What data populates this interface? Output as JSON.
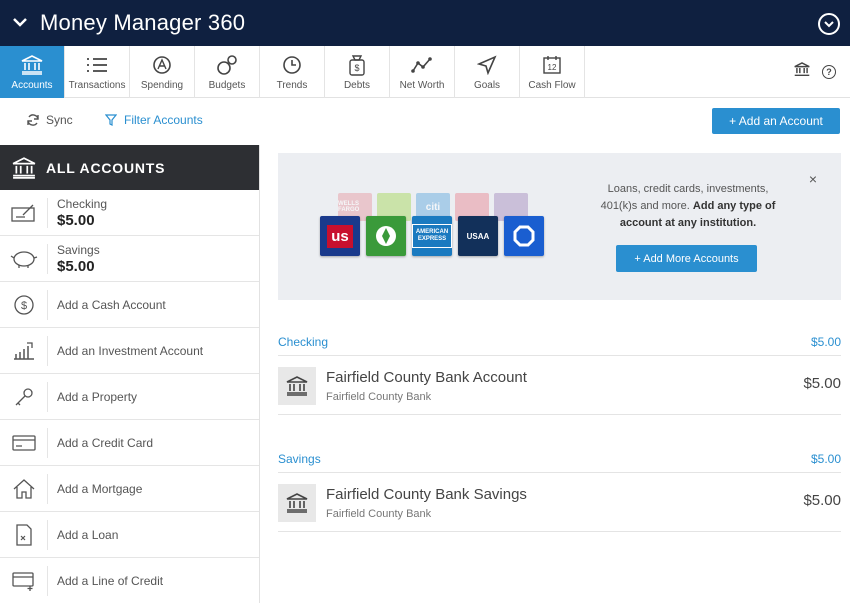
{
  "app": {
    "title": "Money Manager 360"
  },
  "nav": {
    "items": [
      {
        "label": "Accounts",
        "icon": "bank-icon",
        "active": true
      },
      {
        "label": "Transactions",
        "icon": "list-icon"
      },
      {
        "label": "Spending",
        "icon": "spending-icon"
      },
      {
        "label": "Budgets",
        "icon": "budgets-icon"
      },
      {
        "label": "Trends",
        "icon": "clock-icon"
      },
      {
        "label": "Debts",
        "icon": "debts-icon"
      },
      {
        "label": "Net Worth",
        "icon": "networth-icon"
      },
      {
        "label": "Goals",
        "icon": "goals-icon"
      },
      {
        "label": "Cash Flow",
        "icon": "calendar-icon",
        "calendar_day": "12"
      }
    ],
    "right_icons": [
      "bank-icon",
      "help-icon"
    ],
    "help_glyph": "?"
  },
  "toolbar": {
    "sync_label": "Sync",
    "filter_label": "Filter Accounts",
    "add_account_label": "+ Add an Account"
  },
  "sidebar": {
    "header": "ALL ACCOUNTS",
    "accounts": [
      {
        "name": "Checking",
        "balance": "$5.00",
        "icon": "checkbook-icon"
      },
      {
        "name": "Savings",
        "balance": "$5.00",
        "icon": "piggy-bank-icon"
      }
    ],
    "add_items": [
      {
        "label": "Add a Cash Account",
        "icon": "dollar-icon"
      },
      {
        "label": "Add an Investment Account",
        "icon": "chart-icon"
      },
      {
        "label": "Add a Property",
        "icon": "key-icon"
      },
      {
        "label": "Add a Credit Card",
        "icon": "credit-card-icon"
      },
      {
        "label": "Add a Mortgage",
        "icon": "house-icon"
      },
      {
        "label": "Add a Loan",
        "icon": "document-icon"
      },
      {
        "label": "Add a Line of Credit",
        "icon": "credit-line-icon"
      }
    ]
  },
  "promo": {
    "text_plain": "Loans, credit cards, investments, 401(k)s and more.",
    "text_bold": "Add any type of account at any institution.",
    "button_label": "+ Add More Accounts",
    "close_glyph": "×",
    "logos_back": [
      {
        "name": "WELLS FARGO",
        "color": "#e8a0a8"
      },
      {
        "name": "",
        "color": "#a8d860"
      },
      {
        "name": "citi",
        "color": "#6aaee0"
      },
      {
        "name": "",
        "color": "#e88c98"
      },
      {
        "name": "",
        "color": "#a890c0"
      }
    ],
    "logos_front": [
      {
        "name": "us",
        "color": "#1a3a8c"
      },
      {
        "name": "",
        "color": "#3a9a3a"
      },
      {
        "name": "AMERICAN EXPRESS",
        "color": "#1a7ac0"
      },
      {
        "name": "USAA",
        "color": "#12305a"
      },
      {
        "name": "",
        "color": "#1a5ed0"
      }
    ]
  },
  "sections": [
    {
      "title": "Checking",
      "total": "$5.00",
      "accounts": [
        {
          "name": "Fairfield County Bank Account",
          "institution": "Fairfield County Bank",
          "amount": "$5.00"
        }
      ]
    },
    {
      "title": "Savings",
      "total": "$5.00",
      "accounts": [
        {
          "name": "Fairfield County Bank Savings",
          "institution": "Fairfield County Bank",
          "amount": "$5.00"
        }
      ]
    }
  ],
  "colors": {
    "header_bg": "#0f2040",
    "accent": "#2a8fd0",
    "sidebar_header": "#2d2f33"
  }
}
